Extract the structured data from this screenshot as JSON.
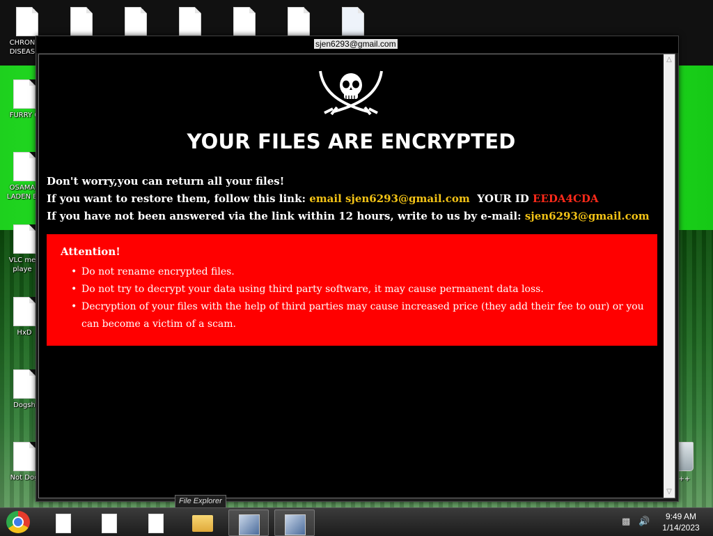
{
  "window": {
    "title": "sjen6293@gmail.com"
  },
  "ransom_note": {
    "headline": "YOUR FILES ARE ENCRYPTED",
    "line1": "Don't worry,you can return all your files!",
    "line2_prefix": "If you want to restore them, follow this link: ",
    "line2_email": "email sjen6293@gmail.com",
    "line2_id_label": "YOUR ID ",
    "line2_id": "EEDA4CDA",
    "line3_prefix": "If you have not been answered via the link within 12 hours, write to us by e-mail: ",
    "line3_email": "sjen6293@gmail.com",
    "attention_title": "Attention!",
    "attention_items": [
      "Do not rename encrypted files.",
      "Do not try to decrypt your data using third party software, it may cause permanent data loss.",
      "Decryption of your files with the help of third parties may cause increased price (they add their fee to our) or you can become a victim of a scam."
    ]
  },
  "desktop": {
    "left_icons": [
      "CHRON DISEAS",
      "FURRY C",
      "OSAMA LADEN B",
      "VLC me playe",
      "HxD",
      "Dogsh",
      "Not Dog"
    ],
    "recycle_label": "n C++"
  },
  "taskbar": {
    "tooltip": "File Explorer",
    "time": "9:49 AM",
    "date": "1/14/2023"
  },
  "colors": {
    "accent_yellow": "#f3c316",
    "alert_red": "#ff0000",
    "id_red": "#ff2a1a"
  },
  "icons": [
    "skull-crossed-swords-logo",
    "chrome-icon",
    "file-explorer-icon",
    "setup-icon",
    "network-icon",
    "volume-icon"
  ]
}
